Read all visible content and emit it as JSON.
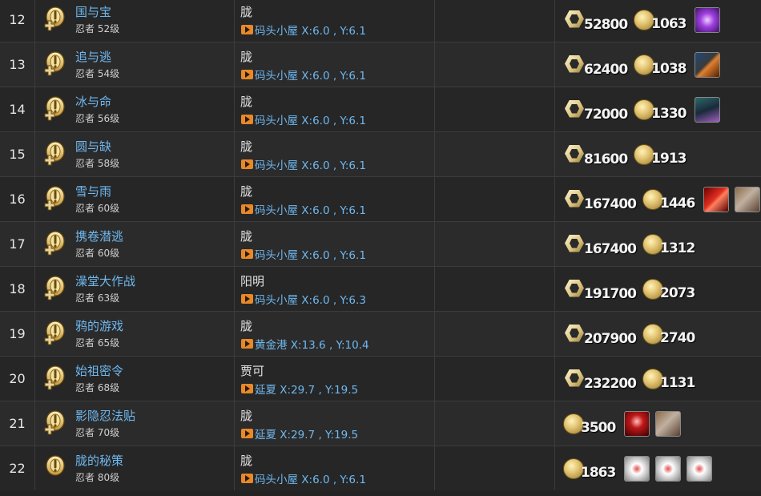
{
  "colors": {
    "link": "#6fb8f0",
    "location_marker": "#e7882a",
    "row_bg": "#262626"
  },
  "rows": [
    {
      "num": "12",
      "name": "国与宝",
      "level": "忍者 52级",
      "giver": "胧",
      "location": "码头小屋 X:6.0 , Y:6.1",
      "xp": "52800",
      "gil": "1063",
      "items": [
        "purple-orb-icon"
      ]
    },
    {
      "num": "13",
      "name": "追与逃",
      "level": "忍者 54级",
      "giver": "胧",
      "location": "码头小屋 X:6.0 , Y:6.1",
      "xp": "62400",
      "gil": "1038",
      "items": [
        "blade-icon"
      ]
    },
    {
      "num": "14",
      "name": "冰与命",
      "level": "忍者 56级",
      "giver": "胧",
      "location": "码头小屋 X:6.0 , Y:6.1",
      "xp": "72000",
      "gil": "1330",
      "items": [
        "monster-icon"
      ]
    },
    {
      "num": "15",
      "name": "圆与缺",
      "level": "忍者 58级",
      "giver": "胧",
      "location": "码头小屋 X:6.0 , Y:6.1",
      "xp": "81600",
      "gil": "1913",
      "items": []
    },
    {
      "num": "16",
      "name": "雪与雨",
      "level": "忍者 60级",
      "giver": "胧",
      "location": "码头小屋 X:6.0 , Y:6.1",
      "xp": "167400",
      "gil": "1446",
      "items": [
        "red-cross-icon",
        "box-icon"
      ]
    },
    {
      "num": "17",
      "name": "携卷潜逃",
      "level": "忍者 60级",
      "giver": "胧",
      "location": "码头小屋 X:6.0 , Y:6.1",
      "xp": "167400",
      "gil": "1312",
      "items": []
    },
    {
      "num": "18",
      "name": "澡堂大作战",
      "level": "忍者 63级",
      "giver": "阳明",
      "location": "码头小屋 X:6.0 , Y:6.3",
      "xp": "191700",
      "gil": "2073",
      "items": []
    },
    {
      "num": "19",
      "name": "鸦的游戏",
      "level": "忍者 65级",
      "giver": "胧",
      "location": "黄金港 X:13.6 , Y:10.4",
      "xp": "207900",
      "gil": "2740",
      "items": []
    },
    {
      "num": "20",
      "name": "始祖密令",
      "level": "忍者 68级",
      "giver": "贾可",
      "location": "延夏 X:29.7 , Y:19.5",
      "xp": "232200",
      "gil": "1131",
      "items": []
    },
    {
      "num": "21",
      "name": "影隐忍法贴",
      "level": "忍者 70级",
      "giver": "胧",
      "location": "延夏 X:29.7 , Y:19.5",
      "xp": "",
      "gil": "3500",
      "items": [
        "crimson-icon",
        "box-icon"
      ]
    },
    {
      "num": "22",
      "name": "胧的秘策",
      "level": "忍者 80级",
      "giver": "胧",
      "location": "码头小屋 X:6.0 , Y:6.1",
      "xp": "",
      "gil": "1863",
      "items": [
        "materia-icon",
        "materia-icon",
        "materia-icon"
      ]
    }
  ]
}
